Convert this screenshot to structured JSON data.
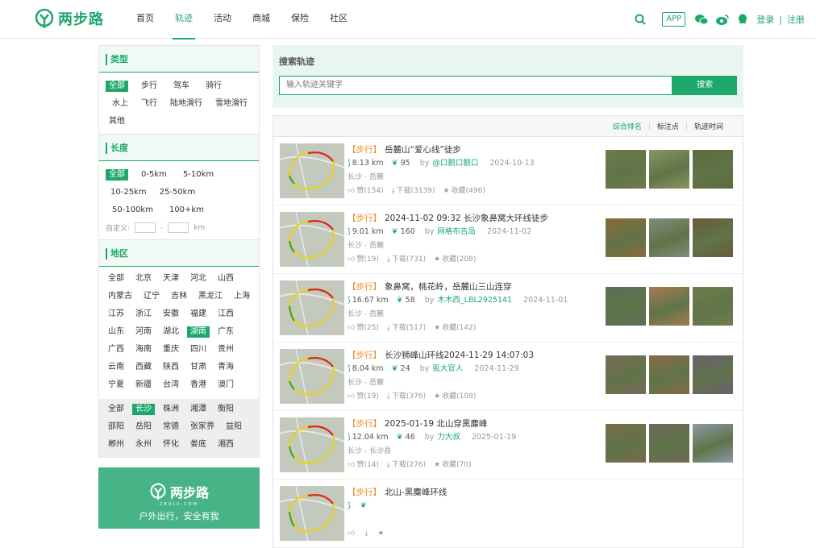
{
  "header": {
    "logo_text": "两步路",
    "nav": [
      {
        "label": "首页",
        "active": false
      },
      {
        "label": "轨迹",
        "active": true
      },
      {
        "label": "活动",
        "active": false
      },
      {
        "label": "商城",
        "active": false
      },
      {
        "label": "保险",
        "active": false
      },
      {
        "label": "社区",
        "active": false
      }
    ],
    "app_label": "APP",
    "login": "登录",
    "separator": "|",
    "register": "注册",
    "accent": "#1ca86a"
  },
  "sidebar": {
    "type_title": "类型",
    "type_options": [
      "全部",
      "步行",
      "驾车",
      "骑行",
      "水上",
      "飞行",
      "陆地滑行",
      "雪地滑行",
      "其他"
    ],
    "length_title": "长度",
    "length_options": [
      "全部",
      "0-5km",
      "5-10km",
      "10-25km",
      "25-50km",
      "50-100km",
      "100+km"
    ],
    "custom_label": "自定义:",
    "custom_dash": "-",
    "custom_unit": "km",
    "region_title": "地区",
    "provinces": [
      "全部",
      "北京",
      "天津",
      "河北",
      "山西",
      "内蒙古",
      "辽宁",
      "吉林",
      "黑龙江",
      "上海",
      "江苏",
      "浙江",
      "安徽",
      "福建",
      "江西",
      "山东",
      "河南",
      "湖北",
      "湖南",
      "广东",
      "广西",
      "海南",
      "重庆",
      "四川",
      "贵州",
      "云南",
      "西藏",
      "陕西",
      "甘肃",
      "青海",
      "宁夏",
      "新疆",
      "台湾",
      "香港",
      "澳门"
    ],
    "selected_province": "湖南",
    "cities": [
      "全部",
      "长沙",
      "株洲",
      "湘潭",
      "衡阳",
      "邵阳",
      "岳阳",
      "常德",
      "张家界",
      "益阳",
      "郴州",
      "永州",
      "怀化",
      "娄底",
      "湘西"
    ],
    "selected_city": "长沙",
    "promo": {
      "logo_text": "两步路",
      "domain": "2BULU.COM",
      "slogan": "户外出行，安全有我"
    }
  },
  "search": {
    "title": "搜索轨迹",
    "placeholder": "输入轨迹关键字",
    "button": "搜索"
  },
  "sort": {
    "options": [
      "综合排名",
      "标注点",
      "轨迹时间"
    ],
    "active": "综合排名"
  },
  "tracks": [
    {
      "tag": "【步行】",
      "title": "岳麓山“爱心线”徒步",
      "distance": "8.13 km",
      "score": "95",
      "by": "by",
      "user": "@口鹅口鹅口",
      "date": "2024-10-13",
      "location": "长沙 - 岳麓",
      "likes": "赞(154)",
      "downloads": "下载(3139)",
      "favorites": "收藏(496)"
    },
    {
      "tag": "【步行】",
      "title": "2024-11-02 09:32 长沙象鼻窝大环线徒步",
      "distance": "9.01 km",
      "score": "160",
      "by": "by",
      "user": "网格布吉岛",
      "date": "2024-11-02",
      "location": "长沙 - 岳麓",
      "likes": "赞(19)",
      "downloads": "下载(731)",
      "favorites": "收藏(208)"
    },
    {
      "tag": "【步行】",
      "title": "象鼻窝，桃花岭，岳麓山三山连穿",
      "distance": "16.67 km",
      "score": "58",
      "by": "by",
      "user": "木木西_LBL2925141",
      "date": "2024-11-01",
      "location": "长沙 - 岳麓",
      "likes": "赞(25)",
      "downloads": "下载(517)",
      "favorites": "收藏(142)"
    },
    {
      "tag": "【步行】",
      "title": "长沙狮峰山环线2024-11-29 14:07:03",
      "distance": "8.04 km",
      "score": "24",
      "by": "by",
      "user": "虱大官人",
      "date": "2024-11-29",
      "location": "长沙 - 岳麓",
      "likes": "赞(19)",
      "downloads": "下载(376)",
      "favorites": "收藏(108)"
    },
    {
      "tag": "【步行】",
      "title": "2025-01-19 北山穿黑麋峰",
      "distance": "12.04 km",
      "score": "46",
      "by": "by",
      "user": "力大叔",
      "date": "2025-01-19",
      "location": "长沙 - 长沙县",
      "likes": "赞(14)",
      "downloads": "下载(276)",
      "favorites": "收藏(70)"
    },
    {
      "tag": "【步行】",
      "title": "北山-黑麋峰环线",
      "distance": "",
      "score": "",
      "by": "",
      "user": "",
      "date": "",
      "location": "",
      "likes": "",
      "downloads": "",
      "favorites": ""
    }
  ]
}
